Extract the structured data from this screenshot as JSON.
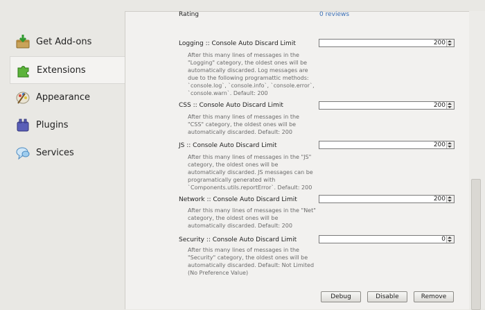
{
  "sidebar": {
    "items": [
      {
        "label": "Get Add-ons",
        "icon": "get-addons-icon"
      },
      {
        "label": "Extensions",
        "icon": "extensions-icon",
        "selected": true
      },
      {
        "label": "Appearance",
        "icon": "appearance-icon"
      },
      {
        "label": "Plugins",
        "icon": "plugins-icon"
      },
      {
        "label": "Services",
        "icon": "services-icon"
      }
    ]
  },
  "details": {
    "rating_label": "Rating",
    "rating_value": "0 reviews"
  },
  "prefs": [
    {
      "title": "Logging :: Console Auto Discard Limit",
      "desc": "After this many lines of messages in the \"Logging\" category, the oldest ones will be automatically discarded. Log messages are due to the following programattic methods: `console.log`, `console.info`, `console.error`, `console.warn`. Default: 200",
      "value": "200"
    },
    {
      "title": "CSS :: Console Auto Discard Limit",
      "desc": "After this many lines of messages in the \"CSS\" category, the oldest ones will be automatically discarded. Default: 200",
      "value": "200"
    },
    {
      "title": "JS :: Console Auto Discard Limit",
      "desc": "After this many lines of messages in the \"JS\" category, the oldest ones will be automatically discarded. JS messages can be programatically generated with `Components.utils.reportError`. Default: 200",
      "value": "200"
    },
    {
      "title": "Network :: Console Auto Discard Limit",
      "desc": "After this many lines of messages in the \"Net\" category, the oldest ones will be automatically discarded. Default: 200",
      "value": "200"
    },
    {
      "title": "Security :: Console Auto Discard Limit",
      "desc": "After this many lines of messages in the \"Security\" category, the oldest ones will be automatically discarded. Default: Not Limited (No Preference Value)",
      "value": "0"
    }
  ],
  "buttons": {
    "debug": "Debug",
    "disable": "Disable",
    "remove": "Remove"
  },
  "colors": {
    "link": "#3a6fb6",
    "sidebar_bg": "#e9e8e4",
    "content_bg": "#f2f1ef"
  }
}
